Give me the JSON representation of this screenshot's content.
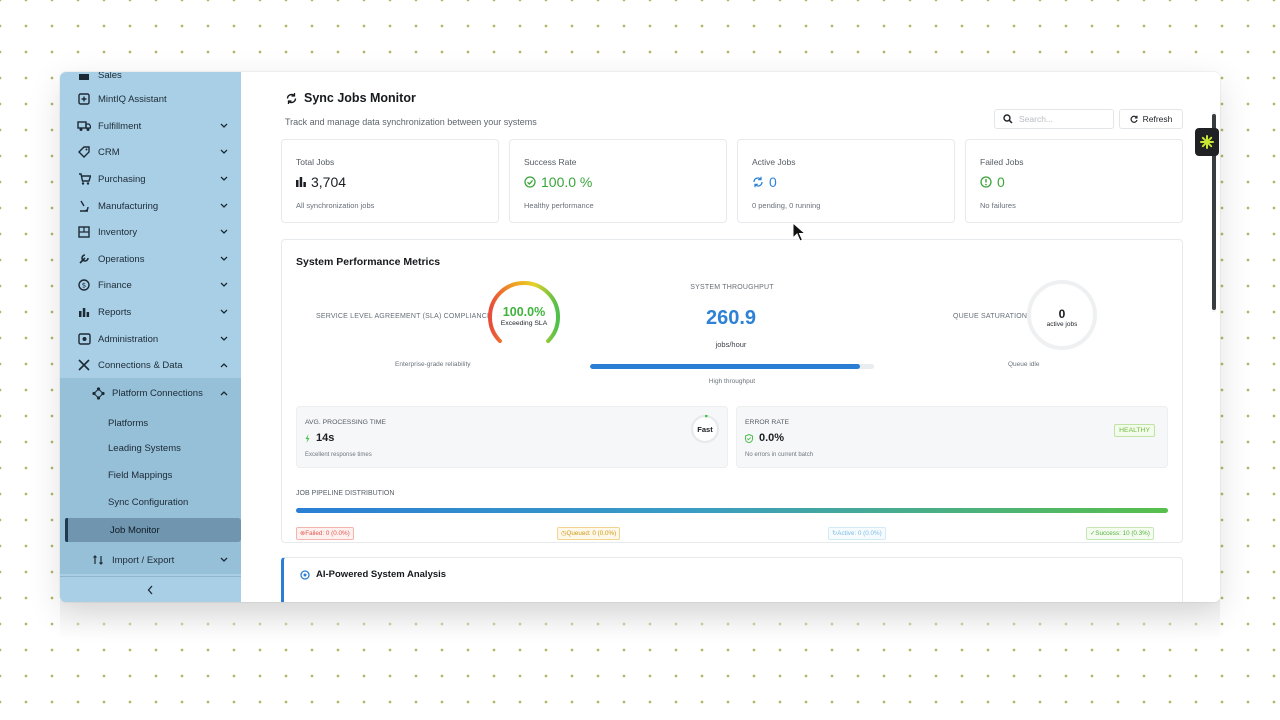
{
  "sidebar": {
    "items": [
      {
        "label": "Sales",
        "icon": "sales-icon"
      },
      {
        "label": "MintIQ Assistant",
        "icon": "plus-square-icon"
      },
      {
        "label": "Fulfillment",
        "icon": "truck-icon"
      },
      {
        "label": "CRM",
        "icon": "tag-icon"
      },
      {
        "label": "Purchasing",
        "icon": "cart-icon"
      },
      {
        "label": "Manufacturing",
        "icon": "microscope-icon"
      },
      {
        "label": "Inventory",
        "icon": "inventory-icon"
      },
      {
        "label": "Operations",
        "icon": "wrench-icon"
      },
      {
        "label": "Finance",
        "icon": "dollar-icon"
      },
      {
        "label": "Reports",
        "icon": "bar-chart-icon"
      },
      {
        "label": "Administration",
        "icon": "admin-icon"
      },
      {
        "label": "Connections & Data",
        "icon": "tools-icon"
      }
    ],
    "platform_connections": "Platform Connections",
    "sub_items": [
      "Platforms",
      "Leading Systems",
      "Field Mappings",
      "Sync Configuration"
    ],
    "active_item": "Job Monitor",
    "import_export": "Import / Export",
    "collapse_icon": "chevron-left-icon"
  },
  "header": {
    "title": "Sync Jobs Monitor",
    "subtitle": "Track and manage data synchronization between your systems",
    "search_placeholder": "Search...",
    "refresh_label": "Refresh"
  },
  "stats": [
    {
      "label": "Total Jobs",
      "value": "3,704",
      "desc": "All synchronization jobs",
      "color": "#1b1f23"
    },
    {
      "label": "Success Rate",
      "value": "100.0 %",
      "desc": "Healthy performance",
      "color": "#3aa53a"
    },
    {
      "label": "Active Jobs",
      "value": "0",
      "desc": "0 pending, 0 running",
      "color": "#2d82d6"
    },
    {
      "label": "Failed Jobs",
      "value": "0",
      "desc": "No failures",
      "color": "#3aa53a"
    }
  ],
  "metrics": {
    "title": "System Performance Metrics",
    "sla": {
      "label": "SERVICE LEVEL AGREEMENT (SLA) COMPLIANCE",
      "value": "100.0%",
      "value_num": 100,
      "caption": "Exceeding SLA",
      "note": "Enterprise-grade reliability"
    },
    "throughput": {
      "label": "SYSTEM THROUGHPUT",
      "value": "260.9",
      "unit": "jobs/hour",
      "note": "High throughput",
      "level": 0.95
    },
    "queue": {
      "label": "QUEUE SATURATION",
      "value": "0",
      "caption": "active jobs",
      "note": "Queue idle",
      "level": 0
    },
    "processing": {
      "label": "AVG. PROCESSING TIME",
      "value": "14s",
      "note": "Excellent response times",
      "badge": "Fast"
    },
    "error": {
      "label": "ERROR RATE",
      "value": "0.0%",
      "note": "No errors in current batch",
      "badge": "HEALTHY"
    },
    "pipeline": {
      "label": "JOB PIPELINE DISTRIBUTION",
      "chips": [
        {
          "label": "Failed: 0 (0.0%)",
          "color": "#e0574f"
        },
        {
          "label": "Queued: 0 (0.0%)",
          "color": "#e0a91f"
        },
        {
          "label": "Active: 0 (0.0%)",
          "color": "#6fb7e4"
        },
        {
          "label": "Success: 10 (0.3%)",
          "color": "#57b343"
        }
      ]
    }
  },
  "ai_analysis": {
    "title": "AI-Powered System Analysis"
  }
}
